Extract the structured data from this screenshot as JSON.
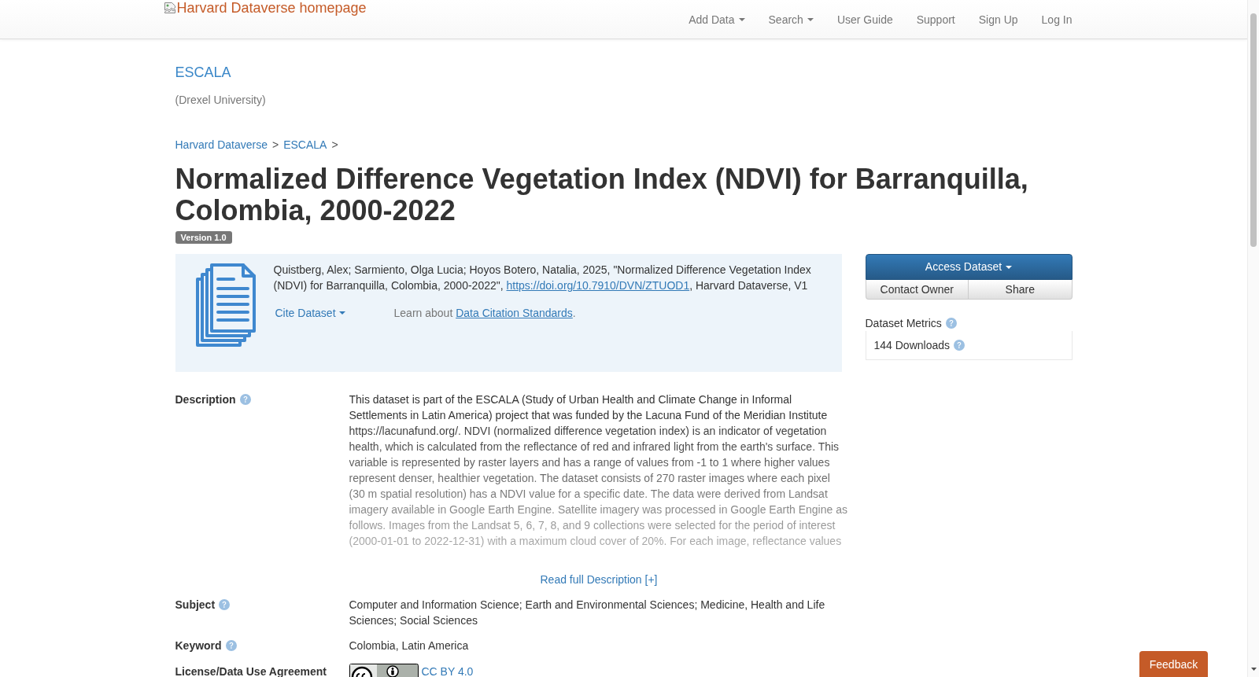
{
  "navbar": {
    "logo_alt": "Harvard Dataverse homepage",
    "items": [
      {
        "label": "Add Data",
        "kind": "dropdown"
      },
      {
        "label": "Search",
        "kind": "dropdown"
      },
      {
        "label": "User Guide",
        "kind": "link"
      },
      {
        "label": "Support",
        "kind": "link"
      },
      {
        "label": "Sign Up",
        "kind": "link"
      },
      {
        "label": "Log In",
        "kind": "link"
      }
    ]
  },
  "dataverse": {
    "name": "ESCALA",
    "affiliation": "(Drexel University)"
  },
  "breadcrumbs": [
    {
      "label": "Harvard Dataverse",
      "separator": ">"
    },
    {
      "label": "ESCALA",
      "separator": ">"
    }
  ],
  "dataset": {
    "title": "Normalized Difference Vegetation Index (NDVI) for Barranquilla, Colombia, 2000-2022",
    "version": "Version 1.0"
  },
  "citation": {
    "text_before": "Quistberg, Alex; Sarmiento, Olga Lucia; Hoyos Botero, Natalia, 2025, \"Normalized Difference Vegetation Index (NDVI) for Barranquilla, Colombia, 2000-2022\", ",
    "doi_link": "https://doi.org/10.7910/DVN/ZTUOD1",
    "text_after": ", Harvard Dataverse, V1",
    "cite_button": "Cite Dataset",
    "standards_note": {
      "text": "Learn about",
      "link": "Data Citation Standards",
      "suffix": "."
    }
  },
  "actions": {
    "access_button": "Access Dataset",
    "contact_button": "Contact Owner",
    "share_button": "Share"
  },
  "metrics": {
    "title": "Dataset Metrics",
    "downloads": "144 Downloads"
  },
  "metadata": [
    {
      "kind": "description",
      "label": "Description",
      "value": "This dataset is part of the ESCALA (Study of Urban Health and Climate Change in Informal Settlements in Latin America) project that was funded by the Lacuna Fund of the Meridian Institute https://lacunafund.org/. NDVI (normalized difference vegetation index) is an indicator of vegetation health, which is calculated from the reflectance of red and infrared light from the earth's surface. This variable is represented by raster layers and has a range of values from -1 to 1 where higher values represent denser, healthier vegetation. The dataset consists of 270 raster images where each pixel (30 m spatial resolution) has a NDVI value for a specific date. The data were derived from Landsat imagery available in Google Earth Engine. Satellite imagery was processed in Google Earth Engine as follows. Images from the Landsat 5, 6, 7, 8, and 9 collections were selected for the period of interest (2000-01-01 to 2022-12-31) with a maximum cloud cover of 20%. For each image, reflectance values",
      "more_link": "Read full Description [+]"
    },
    {
      "kind": "text",
      "label": "Subject",
      "value": "Computer and Information Science; Earth and Environmental Sciences; Medicine, Health and Life Sciences; Social Sciences"
    },
    {
      "kind": "text",
      "label": "Keyword",
      "value": "Colombia, Latin America"
    },
    {
      "kind": "license",
      "label": "License/Data Use Agreement",
      "value": "CC BY 4.0"
    }
  ],
  "feedback_button": "Feedback"
}
